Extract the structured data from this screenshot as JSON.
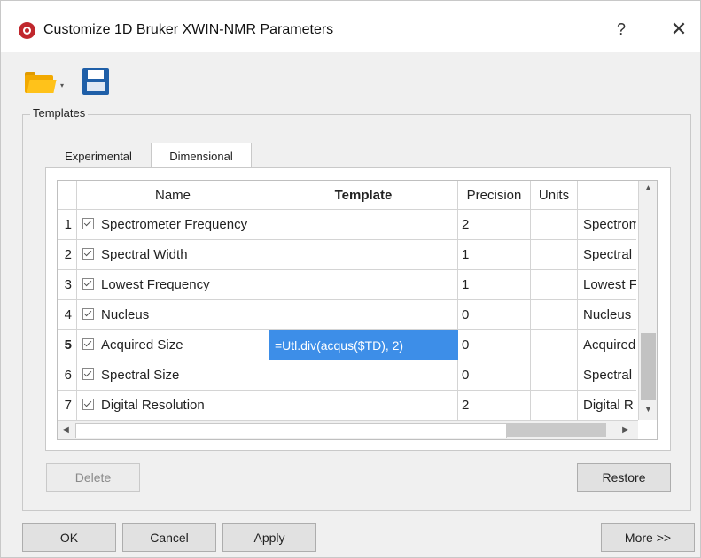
{
  "window": {
    "title": "Customize 1D Bruker XWIN-NMR Parameters",
    "help": "?",
    "close": "✕"
  },
  "toolbar": {
    "open_icon": "folder-open-icon",
    "dropdown_arrow": "▾",
    "save_icon": "save-icon"
  },
  "templates_group": {
    "title": "Templates",
    "tabs": [
      {
        "label": "Experimental",
        "active": false
      },
      {
        "label": "Dimensional",
        "active": true
      }
    ]
  },
  "table": {
    "columns": [
      "",
      "Name",
      "Template",
      "Precision",
      "Units",
      ""
    ],
    "rows": [
      {
        "num": "1",
        "checked": true,
        "name": "Spectrometer Frequency",
        "template": "",
        "precision": "2",
        "units": "",
        "desc": "Spectrometer"
      },
      {
        "num": "2",
        "checked": true,
        "name": "Spectral Width",
        "template": "",
        "precision": "1",
        "units": "",
        "desc": "Spectral"
      },
      {
        "num": "3",
        "checked": true,
        "name": "Lowest Frequency",
        "template": "",
        "precision": "1",
        "units": "",
        "desc": "Lowest F"
      },
      {
        "num": "4",
        "checked": true,
        "name": "Nucleus",
        "template": "",
        "precision": "0",
        "units": "",
        "desc": "Nucleus"
      },
      {
        "num": "5",
        "checked": true,
        "name": "Acquired Size",
        "template": "=Utl.div(acqus($TD), 2)",
        "precision": "0",
        "units": "",
        "desc": "Acquired"
      },
      {
        "num": "6",
        "checked": true,
        "name": "Spectral Size",
        "template": "",
        "precision": "0",
        "units": "",
        "desc": "Spectral"
      },
      {
        "num": "7",
        "checked": true,
        "name": "Digital Resolution",
        "template": "",
        "precision": "2",
        "units": "",
        "desc": "Digital R"
      }
    ],
    "current_row": "5",
    "scroll_up": "▲",
    "scroll_down": "▼",
    "scroll_left": "◀",
    "scroll_right": "▶"
  },
  "buttons": {
    "delete": "Delete",
    "restore": "Restore",
    "ok": "OK",
    "cancel": "Cancel",
    "apply": "Apply",
    "more": "More >>"
  },
  "colors": {
    "selection": "#3d8ee8",
    "folder": "#f2a900",
    "save": "#1f5fa8",
    "app_icon": "#c0272d"
  }
}
